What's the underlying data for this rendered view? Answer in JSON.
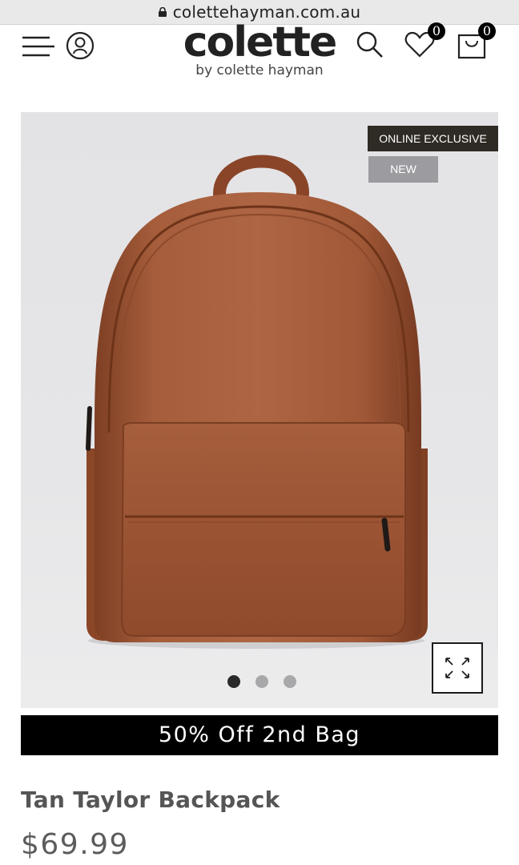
{
  "browser": {
    "url": "colettehayman.com.au"
  },
  "header": {
    "logo": "colette",
    "tagline": "by colette hayman",
    "wishlist_count": "0",
    "cart_count": "0"
  },
  "product": {
    "tags": {
      "exclusive": "ONLINE EXCLUSIVE",
      "new": "NEW"
    },
    "image_count": 3,
    "active_image": 1,
    "promo": "50% Off 2nd Bag",
    "name": "Tan Taylor Backpack",
    "price": "$69.99"
  },
  "colors": {
    "bag": "#a0583a",
    "header_text": "#222222",
    "tag_exclusive": "#2e2a24",
    "tag_new": "#9c9b9f",
    "promo_bg": "#000000"
  }
}
